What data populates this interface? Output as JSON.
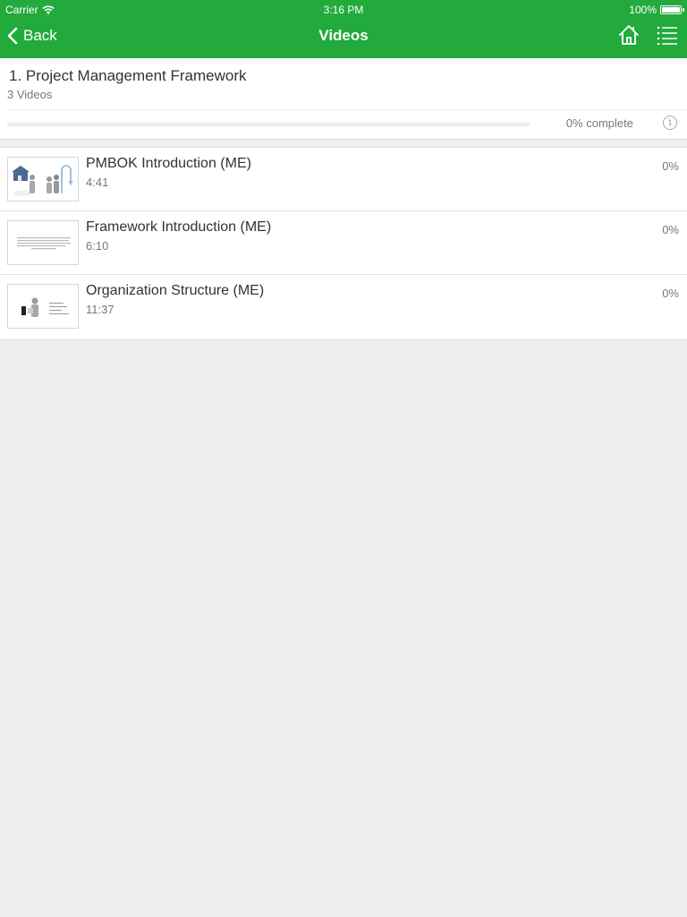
{
  "status_bar": {
    "carrier": "Carrier",
    "time": "3:16 PM",
    "battery": "100%"
  },
  "nav": {
    "back_label": "Back",
    "title": "Videos"
  },
  "section": {
    "title": "1. Project Management Framework",
    "count": "3 Videos",
    "progress_label": "0% complete",
    "progress_fraction": 0,
    "info_glyph": "i"
  },
  "videos": [
    {
      "title": "PMBOK Introduction (ME)",
      "duration": "4:41",
      "percent": "0%"
    },
    {
      "title": "Framework Introduction (ME)",
      "duration": "6:10",
      "percent": "0%"
    },
    {
      "title": "Organization Structure (ME)",
      "duration": "11:37",
      "percent": "0%"
    }
  ],
  "colors": {
    "brand_green": "#22aa3c",
    "background": "#efeff1"
  },
  "icons": {
    "back": "chevron-left-icon",
    "home": "home-icon",
    "menu": "list-icon",
    "info": "info-icon",
    "wifi": "wifi-icon",
    "battery": "battery-icon"
  }
}
